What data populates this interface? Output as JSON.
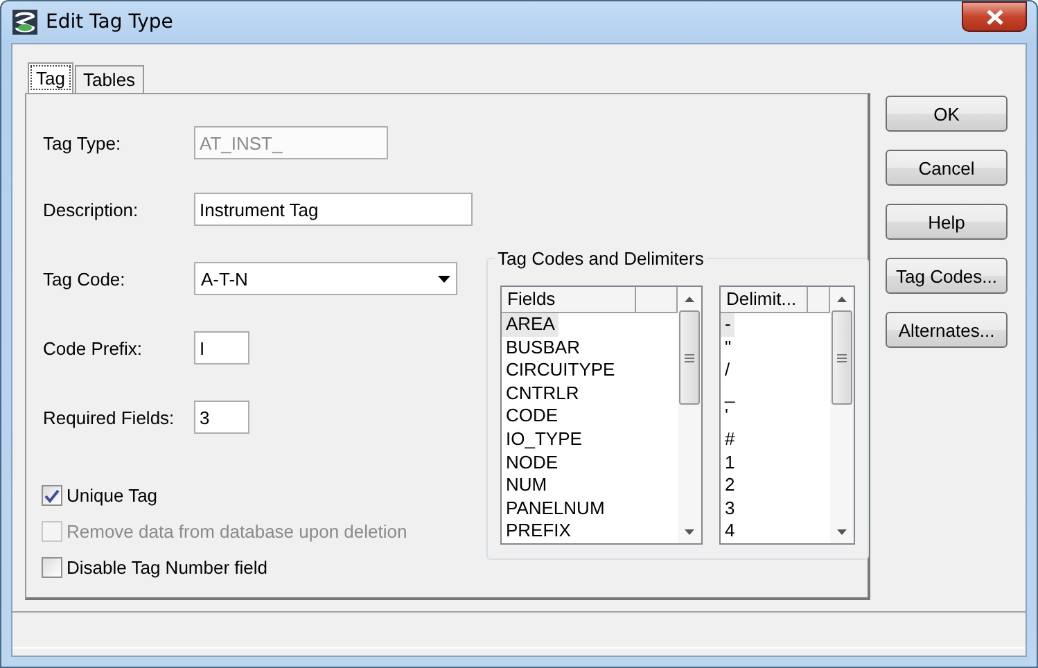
{
  "window": {
    "title": "Edit Tag Type"
  },
  "tabs": [
    {
      "label": "Tag",
      "selected": true
    },
    {
      "label": "Tables",
      "selected": false
    }
  ],
  "form": [
    {
      "kind": "text",
      "label": "Tag Type:",
      "value": "AT_INST_",
      "disabled": true
    },
    {
      "kind": "text",
      "label": "Description:",
      "value": "Instrument Tag",
      "disabled": false
    },
    {
      "kind": "dropdown",
      "label": "Tag Code:",
      "value": "A-T-N",
      "disabled": false
    },
    {
      "kind": "text",
      "label": "Code Prefix:",
      "value": "I",
      "disabled": false
    },
    {
      "kind": "text",
      "label": "Required Fields:",
      "value": "3",
      "disabled": false
    }
  ],
  "checkboxes": [
    {
      "label": "Unique Tag",
      "checked": true,
      "disabled": false
    },
    {
      "label": "Remove data from database upon deletion",
      "checked": false,
      "disabled": true
    },
    {
      "label": "Disable Tag Number field",
      "checked": false,
      "disabled": false
    }
  ],
  "tag_codes_group": {
    "title": "Tag Codes and Delimiters",
    "lists": [
      {
        "header": "Fields",
        "items": [
          {
            "label": "AREA",
            "selected": true
          },
          {
            "label": "BUSBAR",
            "selected": false
          },
          {
            "label": "CIRCUITYPE",
            "selected": false
          },
          {
            "label": "CNTRLR",
            "selected": false
          },
          {
            "label": "CODE",
            "selected": false
          },
          {
            "label": "IO_TYPE",
            "selected": false
          },
          {
            "label": "NODE",
            "selected": false
          },
          {
            "label": "NUM",
            "selected": false
          },
          {
            "label": "PANELNUM",
            "selected": false
          },
          {
            "label": "PREFIX",
            "selected": false
          }
        ]
      },
      {
        "header": "Delimit...",
        "items": [
          {
            "label": "-",
            "selected": true
          },
          {
            "label": "\"",
            "selected": false
          },
          {
            "label": "/",
            "selected": false
          },
          {
            "label": "_",
            "selected": false
          },
          {
            "label": "'",
            "selected": false
          },
          {
            "label": "#",
            "selected": false
          },
          {
            "label": "1",
            "selected": false
          },
          {
            "label": "2",
            "selected": false
          },
          {
            "label": "3",
            "selected": false
          },
          {
            "label": "4",
            "selected": false
          }
        ]
      }
    ]
  },
  "buttons": [
    "OK",
    "Cancel",
    "Help",
    "Tag Codes...",
    "Alternates..."
  ]
}
